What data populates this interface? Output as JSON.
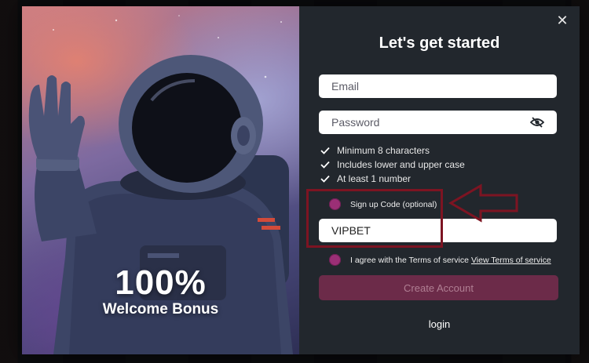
{
  "promo": {
    "headline": "100%",
    "subline": "Welcome Bonus"
  },
  "form": {
    "title": "Let's get started",
    "close_icon": "close-icon",
    "email": {
      "placeholder": "Email",
      "value": ""
    },
    "password": {
      "placeholder": "Password",
      "value": "",
      "toggle_icon": "eye-slash-icon"
    },
    "rules": [
      "Minimum 8 characters",
      "Includes lower and upper case",
      "At least 1 number"
    ],
    "signup_code": {
      "label": "Sign up Code (optional)",
      "value": "VIPBET"
    },
    "terms": {
      "text": "I agree with the Terms of service",
      "link": "View Terms of service"
    },
    "create_account": "Create Account",
    "login": "login"
  },
  "colors": {
    "panel": "#22272d",
    "accent": "#9b2f76",
    "button": "#6c2b49",
    "annotation": "#7d1422"
  }
}
